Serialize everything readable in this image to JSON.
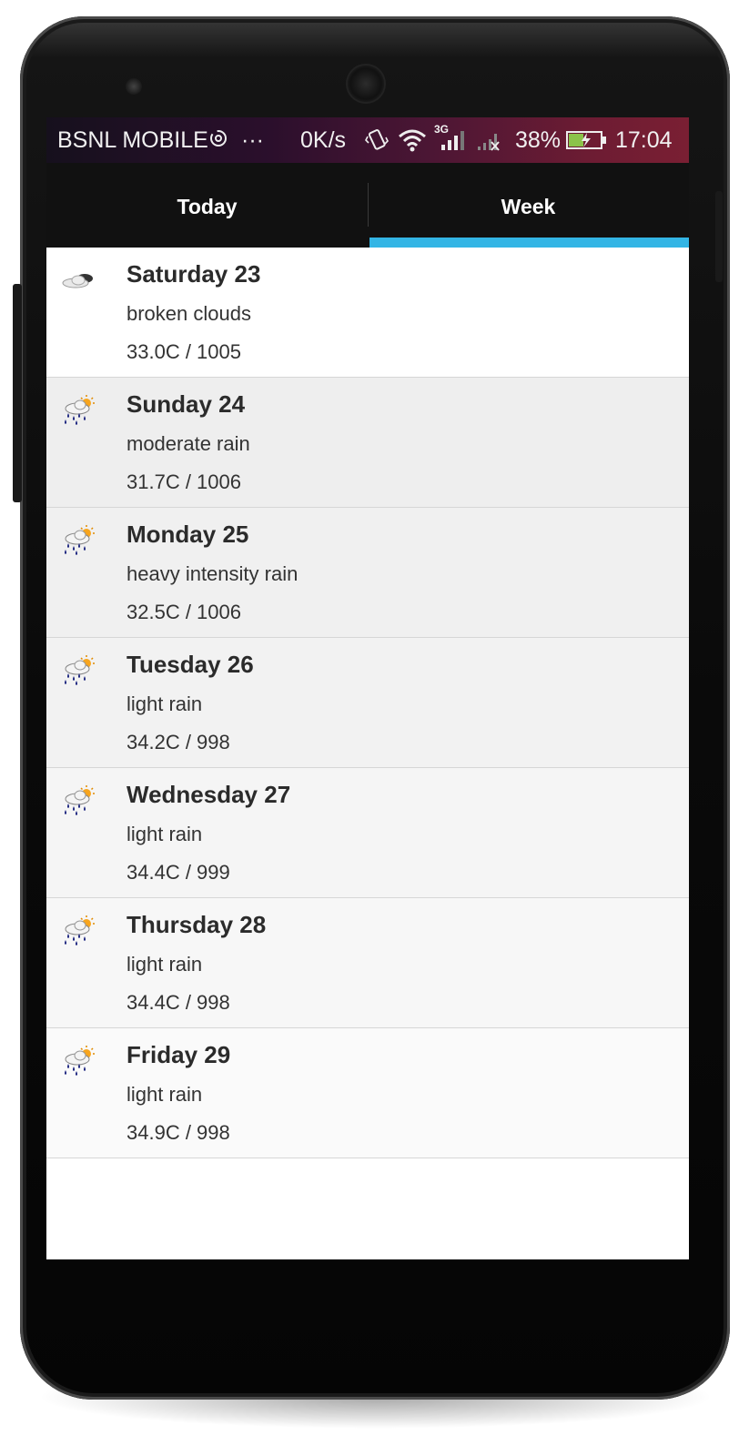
{
  "status_bar": {
    "carrier": "BSNL MOBILE",
    "notification_more": "···",
    "network_speed": "0K/s",
    "network_type": "3G",
    "battery_percent": "38%",
    "time": "17:04"
  },
  "tabs": [
    {
      "label": "Today",
      "selected": false
    },
    {
      "label": "Week",
      "selected": true
    }
  ],
  "accent_color": "#33b5e5",
  "forecast": [
    {
      "day": "Saturday 23",
      "description": "broken clouds",
      "temp_pressure": "33.0C / 1005",
      "icon": "broken-clouds-icon",
      "background": "#ffffff"
    },
    {
      "day": "Sunday 24",
      "description": "moderate rain",
      "temp_pressure": "31.7C / 1006",
      "icon": "rain-sun-icon",
      "background": "#eeeeee"
    },
    {
      "day": "Monday 25",
      "description": "heavy intensity rain",
      "temp_pressure": "32.5C / 1006",
      "icon": "rain-sun-icon",
      "background": "#f0f0f0"
    },
    {
      "day": "Tuesday 26",
      "description": "light rain",
      "temp_pressure": "34.2C / 998",
      "icon": "rain-sun-icon",
      "background": "#f2f2f2"
    },
    {
      "day": "Wednesday 27",
      "description": "light rain",
      "temp_pressure": "34.4C / 999",
      "icon": "rain-sun-icon",
      "background": "#f5f5f5"
    },
    {
      "day": "Thursday 28",
      "description": "light rain",
      "temp_pressure": "34.4C / 998",
      "icon": "rain-sun-icon",
      "background": "#f7f7f7"
    },
    {
      "day": "Friday 29",
      "description": "light rain",
      "temp_pressure": "34.9C / 998",
      "icon": "rain-sun-icon",
      "background": "#fafafa"
    }
  ]
}
